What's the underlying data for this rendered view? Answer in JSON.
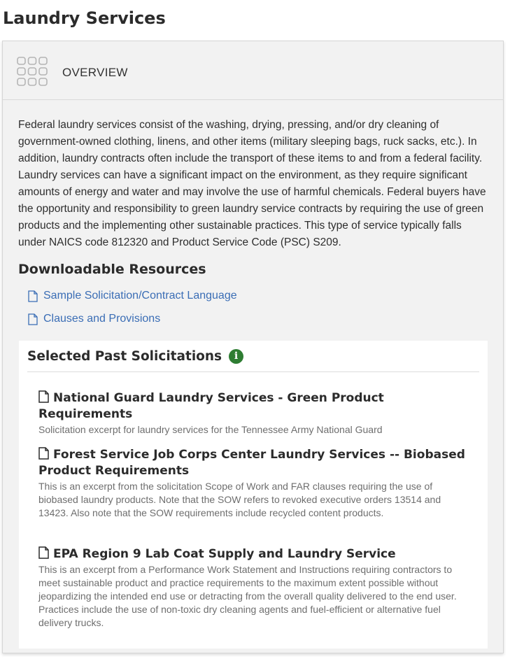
{
  "page": {
    "title": "Laundry Services"
  },
  "overview": {
    "label": "OVERVIEW",
    "text": "Federal laundry services consist of the washing, drying, pressing, and/or dry cleaning of government-owned clothing, linens, and other items (military sleeping bags, ruck sacks, etc.). In addition, laundry contracts often include the transport of these items to and from a federal facility.  Laundry services can have a significant impact on the environment, as they require significant amounts of energy and water and may involve the use of harmful chemicals. Federal buyers have the opportunity and responsibility to green laundry service contracts by requiring the use of green products and the implementing other sustainable practices.  This type of service typically falls under NAICS code 812320 and Product Service Code (PSC) S209."
  },
  "resources": {
    "heading": "Downloadable Resources",
    "items": [
      {
        "label": "Sample Solicitation/Contract Language",
        "icon": "document-icon"
      },
      {
        "label": "Clauses and Provisions",
        "icon": "document-icon"
      }
    ]
  },
  "past_solicitations": {
    "heading": "Selected Past Solicitations",
    "info_icon": "i",
    "items": [
      {
        "title": "National Guard Laundry Services - Green Product Requirements",
        "description": "Solicitation excerpt for laundry services for the Tennessee Army National Guard"
      },
      {
        "title": "Forest Service Job Corps Center Laundry Services -- Biobased Product Requirements",
        "description": "This is an excerpt from the solicitation Scope of Work and FAR clauses requiring the use of biobased laundry products. Note that the SOW refers to revoked executive orders 13514 and 13423. Also note that the SOW requirements include recycled content products."
      },
      {
        "title": "EPA Region 9 Lab Coat Supply and Laundry Service",
        "description": "This is an excerpt from a Performance Work Statement and Instructions requiring contractors to meet sustainable product and practice requirements to the maximum extent possible without jeopardizing the intended end use or detracting from the overall quality delivered to the end user. Practices include the use of non-toxic dry cleaning agents and fuel-efficient or alternative fuel delivery trucks."
      }
    ]
  },
  "colors": {
    "link": "#3a6db5",
    "info_badge": "#2e7d32",
    "card_bg": "#f2f2f2"
  }
}
